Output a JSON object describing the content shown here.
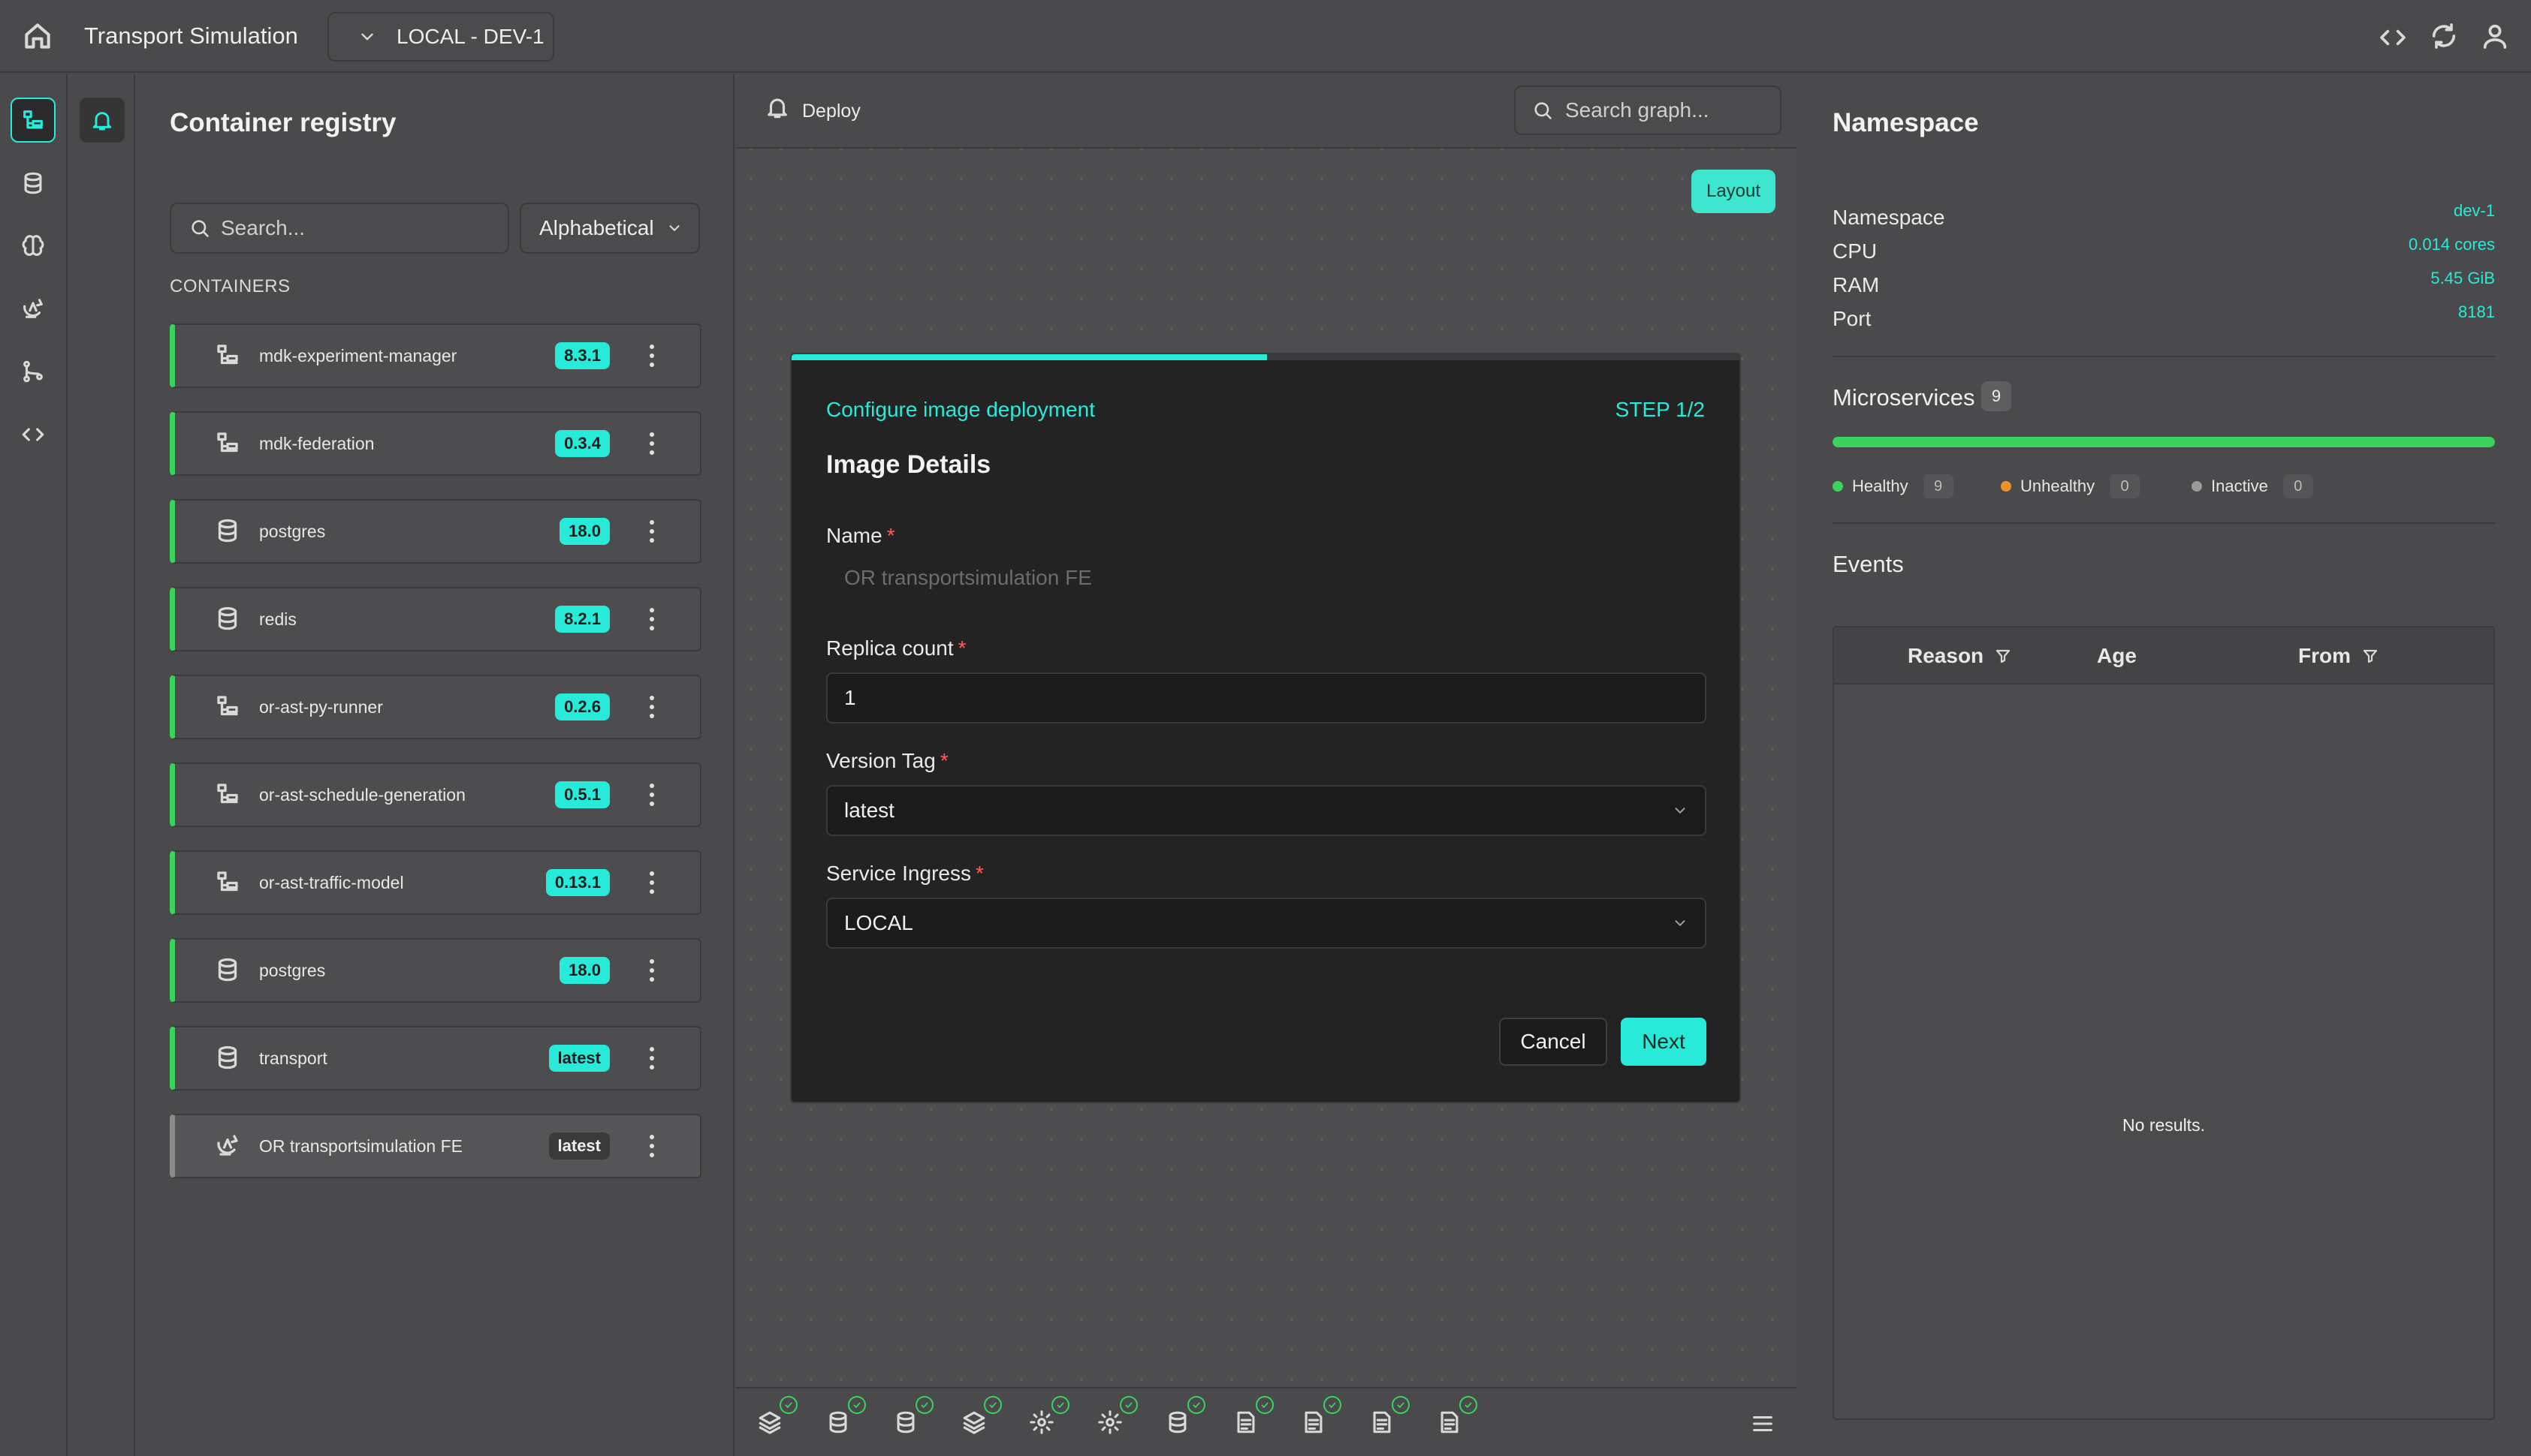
{
  "app": {
    "title": "Transport Simulation",
    "environment": "LOCAL - DEV-1"
  },
  "registry": {
    "title": "Container registry",
    "search_placeholder": "Search...",
    "sort": "Alphabetical",
    "section_label": "CONTAINERS",
    "items": [
      {
        "name": "mdk-experiment-manager",
        "version": "8.3.1",
        "icon": "tree-icon"
      },
      {
        "name": "mdk-federation",
        "version": "0.3.4",
        "icon": "tree-icon"
      },
      {
        "name": "postgres",
        "version": "18.0",
        "icon": "database-icon"
      },
      {
        "name": "redis",
        "version": "8.2.1",
        "icon": "database-icon"
      },
      {
        "name": "or-ast-py-runner",
        "version": "0.2.6",
        "icon": "tree-icon"
      },
      {
        "name": "or-ast-schedule-generation",
        "version": "0.5.1",
        "icon": "tree-icon"
      },
      {
        "name": "or-ast-traffic-model",
        "version": "0.13.1",
        "icon": "tree-icon"
      },
      {
        "name": "postgres",
        "version": "18.0",
        "icon": "database-icon"
      },
      {
        "name": "transport",
        "version": "latest",
        "icon": "database-icon"
      },
      {
        "name": "OR transportsimulation FE",
        "version": "latest",
        "icon": "ingress-icon",
        "selected": true
      }
    ]
  },
  "graph": {
    "deploy_label": "Deploy",
    "search_placeholder": "Search graph...",
    "layout_label": "Layout"
  },
  "namespace": {
    "title": "Namespace",
    "details": [
      {
        "key": "Namespace",
        "value": "dev-1"
      },
      {
        "key": "CPU",
        "value": "0.014 cores"
      },
      {
        "key": "RAM",
        "value": "5.45 GiB"
      },
      {
        "key": "Port",
        "value": "8181"
      }
    ],
    "microservices": {
      "title": "Microservices",
      "count": "9",
      "healthy_fraction": 1.0,
      "legend": [
        {
          "label": "Healthy",
          "count": "9",
          "color": "#3bd35c"
        },
        {
          "label": "Unhealthy",
          "count": "0",
          "color": "#f0922b"
        },
        {
          "label": "Inactive",
          "count": "0",
          "color": "#9a9a9a"
        }
      ]
    },
    "events": {
      "title": "Events",
      "columns": [
        "Reason",
        "Age",
        "From"
      ],
      "empty": "No results."
    }
  },
  "modal": {
    "subtitle": "Configure image deployment",
    "step": "STEP 1/2",
    "progress_fraction": 0.5,
    "title": "Image Details",
    "fields": {
      "name": {
        "label": "Name",
        "placeholder": "OR transportsimulation FE"
      },
      "replica": {
        "label": "Replica count",
        "value": "1"
      },
      "version": {
        "label": "Version Tag",
        "value": "latest"
      },
      "ingress": {
        "label": "Service Ingress",
        "value": "LOCAL"
      }
    },
    "cancel": "Cancel",
    "next": "Next"
  },
  "colors": {
    "accent": "#27ead8",
    "healthy": "#3bd35c",
    "background": "#4a494b"
  }
}
